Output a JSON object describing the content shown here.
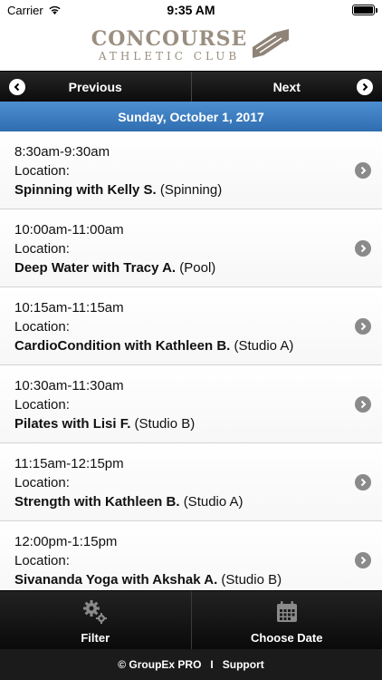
{
  "status_bar": {
    "carrier": "Carrier",
    "time": "9:35 AM"
  },
  "logo": {
    "line1": "CONCOURSE",
    "line2": "ATHLETIC CLUB"
  },
  "nav": {
    "previous_label": "Previous",
    "next_label": "Next"
  },
  "date_header": "Sunday, October 1, 2017",
  "classes": [
    {
      "time": "8:30am-9:30am",
      "location_label": "Location:",
      "name": "Spinning with Kelly S.",
      "room": "(Spinning)"
    },
    {
      "time": "10:00am-11:00am",
      "location_label": "Location:",
      "name": "Deep Water with Tracy A.",
      "room": "(Pool)"
    },
    {
      "time": "10:15am-11:15am",
      "location_label": "Location:",
      "name": "CardioCondition with Kathleen B.",
      "room": "(Studio A)"
    },
    {
      "time": "10:30am-11:30am",
      "location_label": "Location:",
      "name": "Pilates with Lisi F.",
      "room": "(Studio B)"
    },
    {
      "time": "11:15am-12:15pm",
      "location_label": "Location:",
      "name": "Strength with Kathleen B.",
      "room": "(Studio A)"
    },
    {
      "time": "12:00pm-1:15pm",
      "location_label": "Location:",
      "name": "Sivananda Yoga with Akshak A.",
      "room": "(Studio B)"
    }
  ],
  "toolbar": {
    "filter_label": "Filter",
    "choose_date_label": "Choose Date"
  },
  "footer": {
    "brand": "© GroupEx PRO",
    "separator": "I",
    "support": "Support"
  },
  "colors": {
    "date_header": "#3b7ec3",
    "logo": "#9a8e80",
    "toolbar": "#151515",
    "logo_mark": "#8f8377"
  }
}
